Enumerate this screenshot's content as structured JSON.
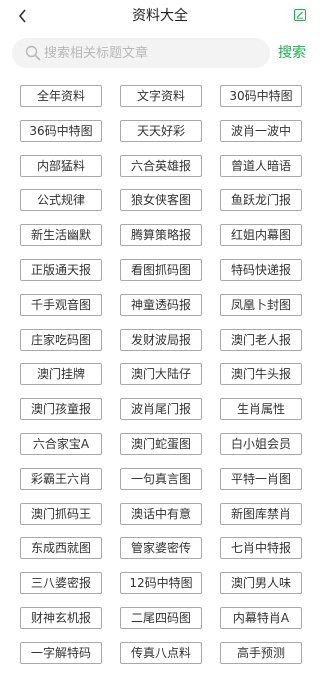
{
  "header": {
    "title": "资料大全",
    "back_icon": "chevron-left-icon",
    "edit_icon": "edit-icon"
  },
  "search": {
    "placeholder": "搜索相关标题文章",
    "button_label": "搜索",
    "accent": "#18b34a"
  },
  "items": [
    "全年资料",
    "文字资料",
    "30码中特图",
    "36码中特图",
    "天天好彩",
    "波肖一波中",
    "内部猛料",
    "六合英雄报",
    "曾道人暗语",
    "公式规律",
    "狼女侠客图",
    "鱼跃龙门报",
    "新生活幽默",
    "腾算策略报",
    "红姐内幕图",
    "正版通天报",
    "看图抓码图",
    "特码快递报",
    "千手观音图",
    "神童透码报",
    "凤凰卜封图",
    "庄家吃码图",
    "发财波局报",
    "澳门老人报",
    "澳门挂牌",
    "澳门大陆仔",
    "澳门牛头报",
    "澳门孩童报",
    "波肖尾门报",
    "生肖属性",
    "六合家宝A",
    "澳门蛇蛋图",
    "白小姐会员",
    "彩霸王六肖",
    "一句真言图",
    "平特一肖图",
    "澳门抓码王",
    "澳话中有意",
    "新图库禁肖",
    "东成西就图",
    "管家婆密传",
    "七肖中特报",
    "三八婆密报",
    "12码中特图",
    "澳门男人味",
    "财神玄机报",
    "二尾四码图",
    "内幕特肖A",
    "一字解特码",
    "传真八点料",
    "高手预测"
  ]
}
